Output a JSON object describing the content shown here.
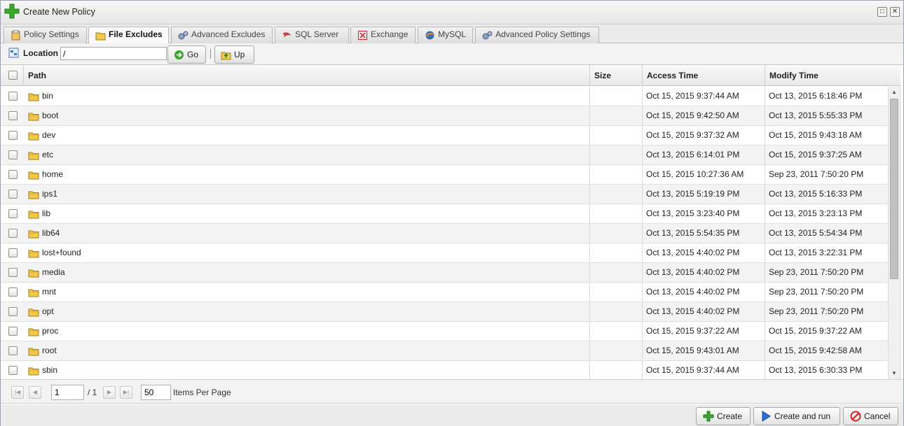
{
  "window": {
    "title": "Create New Policy",
    "maximize": "□",
    "close": "✕"
  },
  "tabs": [
    {
      "label": "Policy Settings",
      "icon": "policy-settings-icon"
    },
    {
      "label": "File Excludes",
      "icon": "folder-icon",
      "active": true
    },
    {
      "label": "Advanced Excludes",
      "icon": "gears-icon"
    },
    {
      "label": "SQL Server",
      "icon": "sql-server-icon"
    },
    {
      "label": "Exchange",
      "icon": "exchange-icon"
    },
    {
      "label": "MySQL",
      "icon": "mysql-icon"
    },
    {
      "label": "Advanced Policy Settings",
      "icon": "gears-icon"
    }
  ],
  "location": {
    "label": "Location",
    "value": "/",
    "go_label": "Go",
    "up_label": "Up"
  },
  "grid": {
    "columns": {
      "path": "Path",
      "size": "Size",
      "access": "Access Time",
      "modify": "Modify Time"
    },
    "rows": [
      {
        "name": "bin",
        "size": "",
        "access": "Oct 15, 2015 9:37:44 AM",
        "modify": "Oct 13, 2015 6:18:46 PM"
      },
      {
        "name": "boot",
        "size": "",
        "access": "Oct 15, 2015 9:42:50 AM",
        "modify": "Oct 13, 2015 5:55:33 PM"
      },
      {
        "name": "dev",
        "size": "",
        "access": "Oct 15, 2015 9:37:32 AM",
        "modify": "Oct 15, 2015 9:43:18 AM"
      },
      {
        "name": "etc",
        "size": "",
        "access": "Oct 13, 2015 6:14:01 PM",
        "modify": "Oct 15, 2015 9:37:25 AM"
      },
      {
        "name": "home",
        "size": "",
        "access": "Oct 15, 2015 10:27:36 AM",
        "modify": "Sep 23, 2011 7:50:20 PM"
      },
      {
        "name": "ips1",
        "size": "",
        "access": "Oct 13, 2015 5:19:19 PM",
        "modify": "Oct 13, 2015 5:16:33 PM"
      },
      {
        "name": "lib",
        "size": "",
        "access": "Oct 13, 2015 3:23:40 PM",
        "modify": "Oct 13, 2015 3:23:13 PM"
      },
      {
        "name": "lib64",
        "size": "",
        "access": "Oct 13, 2015 5:54:35 PM",
        "modify": "Oct 13, 2015 5:54:34 PM"
      },
      {
        "name": "lost+found",
        "size": "",
        "access": "Oct 13, 2015 4:40:02 PM",
        "modify": "Oct 13, 2015 3:22:31 PM"
      },
      {
        "name": "media",
        "size": "",
        "access": "Oct 13, 2015 4:40:02 PM",
        "modify": "Sep 23, 2011 7:50:20 PM"
      },
      {
        "name": "mnt",
        "size": "",
        "access": "Oct 13, 2015 4:40:02 PM",
        "modify": "Sep 23, 2011 7:50:20 PM"
      },
      {
        "name": "opt",
        "size": "",
        "access": "Oct 13, 2015 4:40:02 PM",
        "modify": "Sep 23, 2011 7:50:20 PM"
      },
      {
        "name": "proc",
        "size": "",
        "access": "Oct 15, 2015 9:37:22 AM",
        "modify": "Oct 15, 2015 9:37:22 AM"
      },
      {
        "name": "root",
        "size": "",
        "access": "Oct 15, 2015 9:43:01 AM",
        "modify": "Oct 15, 2015 9:42:58 AM"
      },
      {
        "name": "sbin",
        "size": "",
        "access": "Oct 15, 2015 9:37:44 AM",
        "modify": "Oct 13, 2015 6:30:33 PM"
      }
    ]
  },
  "paging": {
    "page": "1",
    "total": "/ 1",
    "per_page": "50",
    "per_page_label": "Items Per Page"
  },
  "footer": {
    "create": "Create",
    "create_run": "Create and run",
    "cancel": "Cancel"
  },
  "colors": {
    "accent_green": "#3aa82d",
    "folder": "#f2c94c",
    "cancel_red": "#d81e1e",
    "run_blue": "#2c6fd6"
  }
}
